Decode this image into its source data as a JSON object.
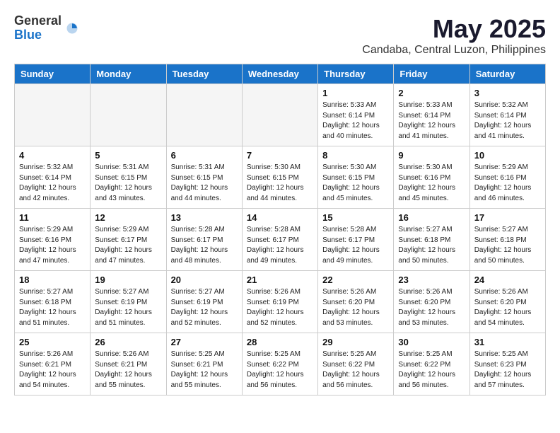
{
  "header": {
    "logo_general": "General",
    "logo_blue": "Blue",
    "title": "May 2025",
    "subtitle": "Candaba, Central Luzon, Philippines"
  },
  "weekdays": [
    "Sunday",
    "Monday",
    "Tuesday",
    "Wednesday",
    "Thursday",
    "Friday",
    "Saturday"
  ],
  "weeks": [
    [
      {
        "day": "",
        "empty": true
      },
      {
        "day": "",
        "empty": true
      },
      {
        "day": "",
        "empty": true
      },
      {
        "day": "",
        "empty": true
      },
      {
        "day": "1",
        "sunrise": "5:33 AM",
        "sunset": "6:14 PM",
        "daylight": "12 hours and 40 minutes."
      },
      {
        "day": "2",
        "sunrise": "5:33 AM",
        "sunset": "6:14 PM",
        "daylight": "12 hours and 41 minutes."
      },
      {
        "day": "3",
        "sunrise": "5:32 AM",
        "sunset": "6:14 PM",
        "daylight": "12 hours and 41 minutes."
      }
    ],
    [
      {
        "day": "4",
        "sunrise": "5:32 AM",
        "sunset": "6:14 PM",
        "daylight": "12 hours and 42 minutes."
      },
      {
        "day": "5",
        "sunrise": "5:31 AM",
        "sunset": "6:15 PM",
        "daylight": "12 hours and 43 minutes."
      },
      {
        "day": "6",
        "sunrise": "5:31 AM",
        "sunset": "6:15 PM",
        "daylight": "12 hours and 44 minutes."
      },
      {
        "day": "7",
        "sunrise": "5:30 AM",
        "sunset": "6:15 PM",
        "daylight": "12 hours and 44 minutes."
      },
      {
        "day": "8",
        "sunrise": "5:30 AM",
        "sunset": "6:15 PM",
        "daylight": "12 hours and 45 minutes."
      },
      {
        "day": "9",
        "sunrise": "5:30 AM",
        "sunset": "6:16 PM",
        "daylight": "12 hours and 45 minutes."
      },
      {
        "day": "10",
        "sunrise": "5:29 AM",
        "sunset": "6:16 PM",
        "daylight": "12 hours and 46 minutes."
      }
    ],
    [
      {
        "day": "11",
        "sunrise": "5:29 AM",
        "sunset": "6:16 PM",
        "daylight": "12 hours and 47 minutes."
      },
      {
        "day": "12",
        "sunrise": "5:29 AM",
        "sunset": "6:17 PM",
        "daylight": "12 hours and 47 minutes."
      },
      {
        "day": "13",
        "sunrise": "5:28 AM",
        "sunset": "6:17 PM",
        "daylight": "12 hours and 48 minutes."
      },
      {
        "day": "14",
        "sunrise": "5:28 AM",
        "sunset": "6:17 PM",
        "daylight": "12 hours and 49 minutes."
      },
      {
        "day": "15",
        "sunrise": "5:28 AM",
        "sunset": "6:17 PM",
        "daylight": "12 hours and 49 minutes."
      },
      {
        "day": "16",
        "sunrise": "5:27 AM",
        "sunset": "6:18 PM",
        "daylight": "12 hours and 50 minutes."
      },
      {
        "day": "17",
        "sunrise": "5:27 AM",
        "sunset": "6:18 PM",
        "daylight": "12 hours and 50 minutes."
      }
    ],
    [
      {
        "day": "18",
        "sunrise": "5:27 AM",
        "sunset": "6:18 PM",
        "daylight": "12 hours and 51 minutes."
      },
      {
        "day": "19",
        "sunrise": "5:27 AM",
        "sunset": "6:19 PM",
        "daylight": "12 hours and 51 minutes."
      },
      {
        "day": "20",
        "sunrise": "5:27 AM",
        "sunset": "6:19 PM",
        "daylight": "12 hours and 52 minutes."
      },
      {
        "day": "21",
        "sunrise": "5:26 AM",
        "sunset": "6:19 PM",
        "daylight": "12 hours and 52 minutes."
      },
      {
        "day": "22",
        "sunrise": "5:26 AM",
        "sunset": "6:20 PM",
        "daylight": "12 hours and 53 minutes."
      },
      {
        "day": "23",
        "sunrise": "5:26 AM",
        "sunset": "6:20 PM",
        "daylight": "12 hours and 53 minutes."
      },
      {
        "day": "24",
        "sunrise": "5:26 AM",
        "sunset": "6:20 PM",
        "daylight": "12 hours and 54 minutes."
      }
    ],
    [
      {
        "day": "25",
        "sunrise": "5:26 AM",
        "sunset": "6:21 PM",
        "daylight": "12 hours and 54 minutes."
      },
      {
        "day": "26",
        "sunrise": "5:26 AM",
        "sunset": "6:21 PM",
        "daylight": "12 hours and 55 minutes."
      },
      {
        "day": "27",
        "sunrise": "5:25 AM",
        "sunset": "6:21 PM",
        "daylight": "12 hours and 55 minutes."
      },
      {
        "day": "28",
        "sunrise": "5:25 AM",
        "sunset": "6:22 PM",
        "daylight": "12 hours and 56 minutes."
      },
      {
        "day": "29",
        "sunrise": "5:25 AM",
        "sunset": "6:22 PM",
        "daylight": "12 hours and 56 minutes."
      },
      {
        "day": "30",
        "sunrise": "5:25 AM",
        "sunset": "6:22 PM",
        "daylight": "12 hours and 56 minutes."
      },
      {
        "day": "31",
        "sunrise": "5:25 AM",
        "sunset": "6:23 PM",
        "daylight": "12 hours and 57 minutes."
      }
    ]
  ]
}
